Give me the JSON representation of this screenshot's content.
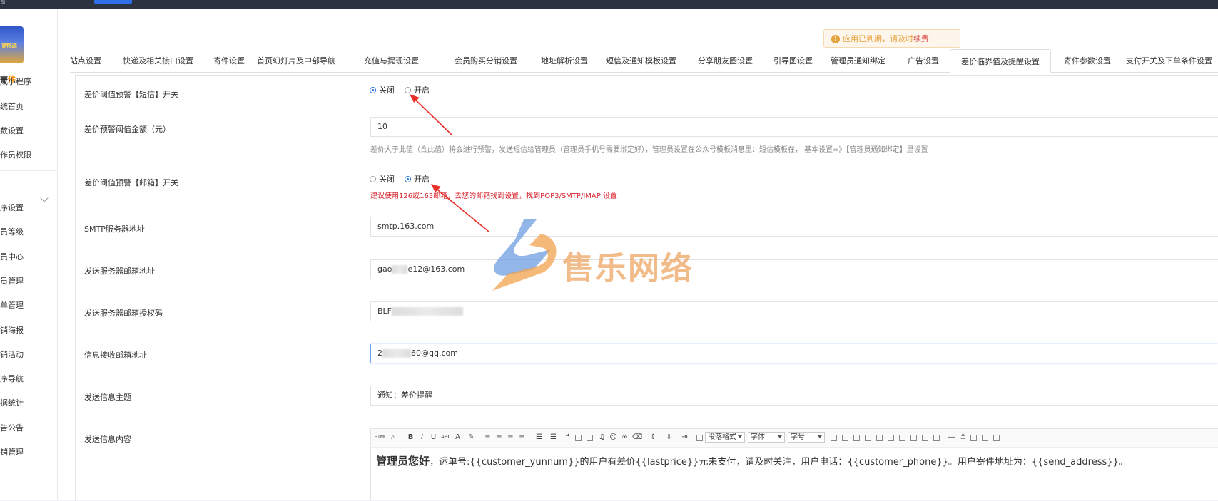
{
  "topbar": {
    "logo_glyph": "奇"
  },
  "sidebar": {
    "logo_text": "寄快递",
    "brand": {
      "main": "寄",
      "highlight": "件"
    },
    "items": [
      {
        "label": "成小程序"
      },
      {
        "label": "统首页"
      },
      {
        "label": "数设置"
      },
      {
        "label": "作员权限"
      },
      {
        "label": "序设置"
      },
      {
        "label": "员等级"
      },
      {
        "label": "员中心"
      },
      {
        "label": "员管理"
      },
      {
        "label": "单管理"
      },
      {
        "label": "销海报"
      },
      {
        "label": "销活动"
      },
      {
        "label": "序导航"
      },
      {
        "label": "据统计"
      },
      {
        "label": "告公告"
      },
      {
        "label": "销管理"
      }
    ]
  },
  "notice": {
    "prefix": "应用已到期，请及时",
    "highlight": "续费"
  },
  "tabs": [
    {
      "label": "站点设置"
    },
    {
      "label": "快递及相关接口设置"
    },
    {
      "label": "寄件设置"
    },
    {
      "label": "首页幻灯片及中部导航"
    },
    {
      "label": "充值与提现设置"
    },
    {
      "label": "会员购买分销设置"
    },
    {
      "label": "地址解析设置"
    },
    {
      "label": "短信及通知模板设置"
    },
    {
      "label": "分享朋友圈设置"
    },
    {
      "label": "引导图设置"
    },
    {
      "label": "管理员通知绑定"
    },
    {
      "label": "广告设置"
    },
    {
      "label": "差价临界值及提醒设置"
    },
    {
      "label": "寄件参数设置"
    },
    {
      "label": "支付开关及下单条件设置"
    }
  ],
  "active_tab": "差价临界值及提醒设置",
  "form": {
    "sms_switch": {
      "label": "差价阈值预警【短信】开关",
      "off": "关闭",
      "on": "开启",
      "selected": "关闭"
    },
    "threshold": {
      "label": "差价预警阈值金额（元）",
      "value": "10",
      "help": "差价大于此值（含此值）将会进行预警，发送短信给管理员（管理员手机号需要绑定好），管理员设置在公众号模板消息里：短信模板在，  基本设置=》【管理员通知绑定】里设置"
    },
    "mail_switch": {
      "label": "差价阈值预警【邮箱】开关",
      "off": "关闭",
      "on": "开启",
      "selected": "开启",
      "hint": "建议使用126或163邮箱，去您的邮箱找到设置，找到POP3/SMTP/IMAP 设置"
    },
    "smtp": {
      "label": "SMTP服务器地址",
      "value": "smtp.163.com"
    },
    "sender": {
      "label": "发送服务器邮箱地址",
      "value_prefix": "gao",
      "value_suffix": "e12@163.com"
    },
    "auth_code": {
      "label": "发送服务器邮箱授权码",
      "value_prefix": "BLF"
    },
    "receiver": {
      "label": "信息接收邮箱地址",
      "value_prefix": "2",
      "value_suffix": "60@qq.com"
    },
    "subject": {
      "label": "发送信息主题",
      "value": "通知：差价提醒"
    },
    "content": {
      "label": "发送信息内容",
      "bold": "管理员您好",
      "body": "，运单号:{{customer_yunnum}}的用户有差价{{lastprice}}元未支付，请及时关注，用户电话：{{customer_phone}}。用户寄件地址为：{{send_address}}。"
    }
  },
  "editor_toolbar": {
    "paragraph_format": "段落格式",
    "font_family": "字体",
    "font_size": "字号",
    "html_label": "HTML"
  },
  "watermark": {
    "text": "售乐网络"
  },
  "colors": {
    "accent": "#1e6fd9",
    "warning": "#e6a23c",
    "error": "#d9232e",
    "arrow": "#e8312a"
  }
}
